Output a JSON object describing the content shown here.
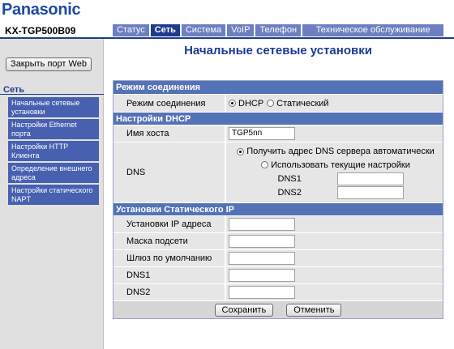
{
  "brand": {
    "logo": "Panasonic",
    "model": "KX-TGP500B09"
  },
  "tabs": [
    {
      "label": "Статус"
    },
    {
      "label": "Сеть"
    },
    {
      "label": "Система"
    },
    {
      "label": "VoIP"
    },
    {
      "label": "Телефон"
    },
    {
      "label": "Техническое обслуживание"
    }
  ],
  "sidebar": {
    "close_button": "Закрыть порт Web",
    "heading": "Сеть",
    "items": [
      {
        "label": "Начальные сетевые установки"
      },
      {
        "label": "Настройки Ethernet порта"
      },
      {
        "label": "Настройки HTTP Клиента"
      },
      {
        "label": "Определение внешнего адреса"
      },
      {
        "label": "Настройки статического NAPT"
      }
    ]
  },
  "page": {
    "title": "Начальные сетевые установки",
    "connection": {
      "header": "Режим соединения",
      "mode_label": "Режим соединения",
      "dhcp_option": "DHCP",
      "static_option": "Статический",
      "selected": "DHCP"
    },
    "dhcp": {
      "header": "Настройки DHCP",
      "hostname_label": "Имя хоста",
      "hostname_value": "TGP5nn",
      "dns_label": "DNS",
      "dns_auto_option": "Получить адрес DNS сервера автоматически",
      "dns_manual_option": "Использовать текущие настройки",
      "dns1_label": "DNS1",
      "dns2_label": "DNS2",
      "dns1_value": "",
      "dns2_value": "",
      "selected": "auto"
    },
    "static": {
      "header": "Установки Статического IP",
      "fields": [
        {
          "label": "Установки IP адреса",
          "value": ""
        },
        {
          "label": "Маска подсети",
          "value": ""
        },
        {
          "label": "Шлюз по умолчанию",
          "value": ""
        },
        {
          "label": "DNS1",
          "value": ""
        },
        {
          "label": "DNS2",
          "value": ""
        }
      ]
    },
    "buttons": {
      "save": "Сохранить",
      "cancel": "Отменить"
    }
  },
  "colors": {
    "brand_blue": "#1b4aa3",
    "tab_inactive": "#6d7fc0",
    "tab_active": "#1f3b8f",
    "section_header": "#5472b6",
    "sidebar_item": "#4760b0"
  }
}
